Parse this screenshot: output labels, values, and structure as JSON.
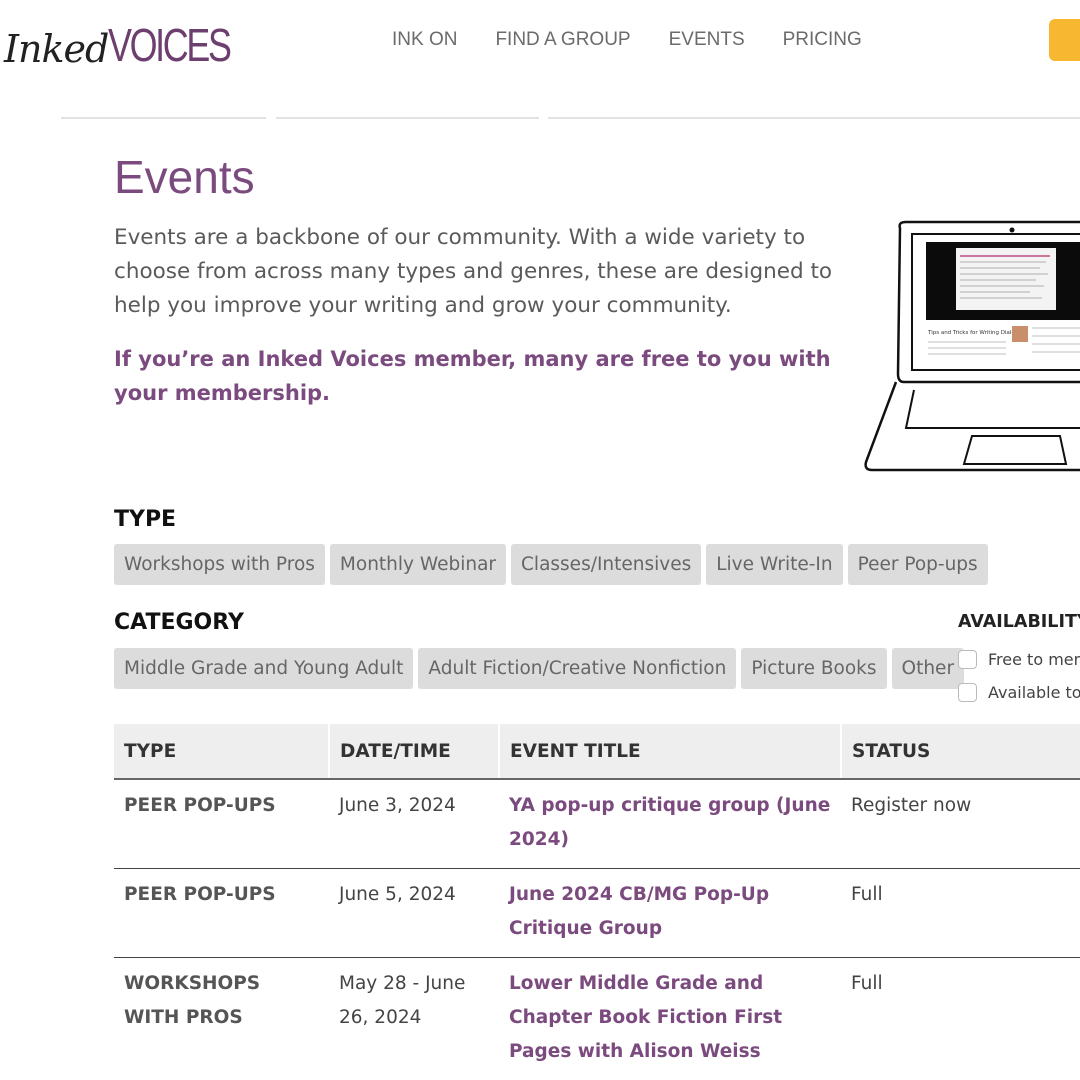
{
  "header": {
    "logo_inked": "Inked",
    "logo_voices": "VOICES",
    "nav": [
      "INK ON",
      "FIND A GROUP",
      "EVENTS",
      "PRICING"
    ]
  },
  "page": {
    "title": "Events",
    "intro": "Events are a backbone of our community. With a wide variety to choose from across many types and genres, these are designed to help you improve your writing and grow your community.",
    "member_note": "If you’re an Inked Voices member, many are free to you with your membership.",
    "laptop_screen_title": "Tips and Tricks for Writing Dialogue"
  },
  "filters": {
    "type_heading": "TYPE",
    "types": [
      "Workshops with Pros",
      "Monthly Webinar",
      "Classes/Intensives",
      "Live Write-In",
      "Peer Pop-ups"
    ],
    "category_heading": "CATEGORY",
    "categories": [
      "Middle Grade and Young Adult",
      "Adult Fiction/Creative Nonfiction",
      "Picture Books",
      "Other"
    ],
    "availability_heading": "AVAILABILITY",
    "availability": [
      "Free to mem",
      "Available to"
    ]
  },
  "table": {
    "headers": [
      "TYPE",
      "DATE/TIME",
      "EVENT TITLE",
      "STATUS"
    ],
    "rows": [
      {
        "type": "PEER POP-UPS",
        "date": "June 3, 2024",
        "title": "YA pop-up critique group (June 2024)",
        "status": "Register now"
      },
      {
        "type": "PEER POP-UPS",
        "date": "June 5, 2024",
        "title": "June 2024 CB/MG Pop-Up Critique Group",
        "status": "Full"
      },
      {
        "type": "WORKSHOPS WITH PROS",
        "date": "May 28 - June 26, 2024",
        "title": "Lower Middle Grade and Chapter Book Fiction First Pages with Alison Weiss",
        "status": "Full"
      }
    ]
  },
  "colors": {
    "brand_purple": "#7b4a7e",
    "cta_yellow": "#f7b731",
    "chip_bg": "#dcdcdc"
  }
}
